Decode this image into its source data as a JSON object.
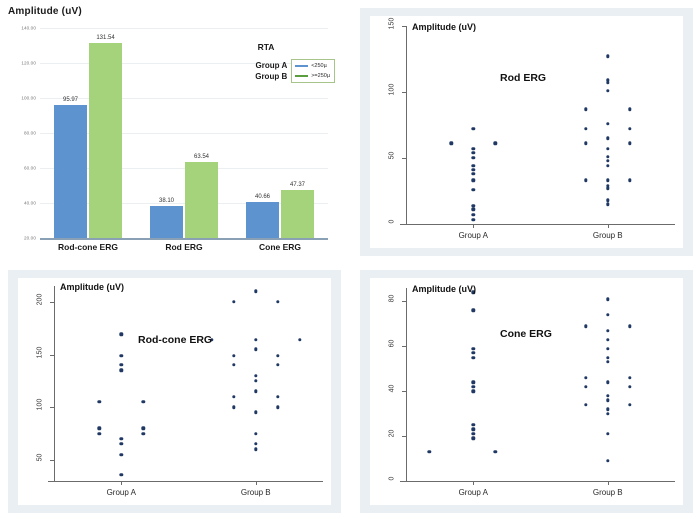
{
  "figure": {
    "panels": [
      "bar-chart-rta",
      "scatter-rod-erg",
      "scatter-rod-cone-erg",
      "scatter-cone-erg"
    ]
  },
  "colors": {
    "group_a_blue": "#5d93ce",
    "group_b_green": "#a5d37b",
    "legend_green_line": "#5a9e3f",
    "dot_navy": "#1f3864",
    "panel_background": "#e9eff3",
    "plot_background": "#ffffff"
  },
  "bar_chart": {
    "axis_title": "Amplitude (uV)",
    "legend": {
      "title": "RTA",
      "group_labels": [
        "Group A",
        "Group B"
      ],
      "entries": [
        {
          "label": "<250µ",
          "color": "#5d93ce"
        },
        {
          "label": ">=250µ",
          "color": "#5a9e3f"
        }
      ]
    },
    "chart_data": {
      "type": "bar",
      "title": "Amplitude (uV)",
      "xlabel": "",
      "ylabel": "Amplitude (uV)",
      "ylim": [
        20,
        140
      ],
      "yticks": [
        "20.00",
        "40.00",
        "60.00",
        "80.00",
        "100.00",
        "120.00",
        "140.00"
      ],
      "grid": true,
      "legend_position": "top-right",
      "categories": [
        "Rod-cone ERG",
        "Rod ERG",
        "Cone ERG"
      ],
      "series": [
        {
          "name": "Group A",
          "legend": "<250µ",
          "color": "#5d93ce",
          "values": [
            95.97,
            38.1,
            40.66
          ],
          "labels": [
            "95.97",
            "38.10",
            "40.66"
          ]
        },
        {
          "name": "Group B",
          "legend": ">=250µ",
          "color": "#a5d37b",
          "values": [
            131.54,
            63.54,
            47.37
          ],
          "labels": [
            "131.54",
            "63.54",
            "47.37"
          ]
        }
      ]
    }
  },
  "scatter_rod": {
    "axis_title": "Amplitude (uV)",
    "chart_data": {
      "type": "scatter",
      "title": "Rod ERG",
      "xlabel": "",
      "ylabel": "Amplitude (uV)",
      "ylim": [
        0,
        150
      ],
      "yticks": [
        0,
        50,
        100,
        150
      ],
      "grid": false,
      "categories": [
        "Group A",
        "Group B"
      ],
      "series": [
        {
          "name": "Group A",
          "points": [
            {
              "offset": -1,
              "y": 61
            },
            {
              "offset": 1,
              "y": 61
            },
            {
              "offset": 0,
              "y": 72
            },
            {
              "offset": 0,
              "y": 57
            },
            {
              "offset": 0,
              "y": 54
            },
            {
              "offset": 0,
              "y": 50
            },
            {
              "offset": 0,
              "y": 44
            },
            {
              "offset": 0,
              "y": 41
            },
            {
              "offset": 0,
              "y": 38
            },
            {
              "offset": 0,
              "y": 33
            },
            {
              "offset": 0,
              "y": 26
            },
            {
              "offset": 0,
              "y": 14
            },
            {
              "offset": 0,
              "y": 11
            },
            {
              "offset": 0,
              "y": 7
            },
            {
              "offset": 0,
              "y": 3
            }
          ]
        },
        {
          "name": "Group B",
          "points": [
            {
              "offset": 0,
              "y": 127
            },
            {
              "offset": 0,
              "y": 109
            },
            {
              "offset": 0,
              "y": 107
            },
            {
              "offset": 0,
              "y": 101
            },
            {
              "offset": -1,
              "y": 87
            },
            {
              "offset": 1,
              "y": 87
            },
            {
              "offset": -1,
              "y": 72
            },
            {
              "offset": 0,
              "y": 76
            },
            {
              "offset": 1,
              "y": 72
            },
            {
              "offset": -1,
              "y": 61
            },
            {
              "offset": 0,
              "y": 65
            },
            {
              "offset": 1,
              "y": 61
            },
            {
              "offset": 0,
              "y": 57
            },
            {
              "offset": 0,
              "y": 51
            },
            {
              "offset": 0,
              "y": 48
            },
            {
              "offset": 0,
              "y": 44
            },
            {
              "offset": -1,
              "y": 33
            },
            {
              "offset": 0,
              "y": 33
            },
            {
              "offset": 1,
              "y": 33
            },
            {
              "offset": 0,
              "y": 29
            },
            {
              "offset": 0,
              "y": 27
            },
            {
              "offset": 0,
              "y": 18
            },
            {
              "offset": 0,
              "y": 15
            }
          ]
        }
      ]
    }
  },
  "scatter_rod_cone": {
    "axis_title": "Amplitude (uV)",
    "chart_data": {
      "type": "scatter",
      "title": "Rod-cone ERG",
      "xlabel": "",
      "ylabel": "Amplitude (uV)",
      "ylim": [
        30,
        215
      ],
      "yticks": [
        50,
        100,
        150,
        200
      ],
      "grid": false,
      "categories": [
        "Group A",
        "Group B"
      ],
      "series": [
        {
          "name": "Group A",
          "points": [
            {
              "offset": 0,
              "y": 169
            },
            {
              "offset": 0,
              "y": 149
            },
            {
              "offset": 0,
              "y": 140
            },
            {
              "offset": 0,
              "y": 135
            },
            {
              "offset": -1,
              "y": 105
            },
            {
              "offset": 1,
              "y": 105
            },
            {
              "offset": -1,
              "y": 80
            },
            {
              "offset": 1,
              "y": 80
            },
            {
              "offset": -1,
              "y": 75
            },
            {
              "offset": 1,
              "y": 75
            },
            {
              "offset": 0,
              "y": 70
            },
            {
              "offset": 0,
              "y": 65
            },
            {
              "offset": 0,
              "y": 55
            },
            {
              "offset": 0,
              "y": 36
            }
          ]
        },
        {
          "name": "Group B",
          "points": [
            {
              "offset": 0,
              "y": 210
            },
            {
              "offset": -1,
              "y": 200
            },
            {
              "offset": 1,
              "y": 200
            },
            {
              "offset": -2,
              "y": 164
            },
            {
              "offset": 0,
              "y": 164
            },
            {
              "offset": 2,
              "y": 164
            },
            {
              "offset": 0,
              "y": 155
            },
            {
              "offset": -1,
              "y": 149
            },
            {
              "offset": 1,
              "y": 149
            },
            {
              "offset": -1,
              "y": 140
            },
            {
              "offset": 1,
              "y": 140
            },
            {
              "offset": 0,
              "y": 130
            },
            {
              "offset": 0,
              "y": 125
            },
            {
              "offset": 0,
              "y": 115
            },
            {
              "offset": -1,
              "y": 110
            },
            {
              "offset": 1,
              "y": 110
            },
            {
              "offset": -1,
              "y": 100
            },
            {
              "offset": 1,
              "y": 100
            },
            {
              "offset": 0,
              "y": 95
            },
            {
              "offset": 0,
              "y": 75
            },
            {
              "offset": 0,
              "y": 65
            },
            {
              "offset": 0,
              "y": 60
            }
          ]
        }
      ]
    }
  },
  "scatter_cone": {
    "axis_title": "Amplitude (uV)",
    "chart_data": {
      "type": "scatter",
      "title": "Cone ERG",
      "xlabel": "",
      "ylabel": "Amplitude (uV)",
      "ylim": [
        0,
        86
      ],
      "yticks": [
        0,
        20,
        40,
        60,
        80
      ],
      "grid": false,
      "categories": [
        "Group A",
        "Group B"
      ],
      "series": [
        {
          "name": "Group A",
          "points": [
            {
              "offset": 0,
              "y": 84
            },
            {
              "offset": 0,
              "y": 76
            },
            {
              "offset": 0,
              "y": 59
            },
            {
              "offset": 0,
              "y": 57
            },
            {
              "offset": 0,
              "y": 55
            },
            {
              "offset": 0,
              "y": 44
            },
            {
              "offset": 0,
              "y": 42
            },
            {
              "offset": 0,
              "y": 40
            },
            {
              "offset": 0,
              "y": 25
            },
            {
              "offset": 0,
              "y": 23
            },
            {
              "offset": 0,
              "y": 21
            },
            {
              "offset": 0,
              "y": 19
            },
            {
              "offset": -2,
              "y": 13
            },
            {
              "offset": 1,
              "y": 13
            }
          ]
        },
        {
          "name": "Group B",
          "points": [
            {
              "offset": 0,
              "y": 81
            },
            {
              "offset": 0,
              "y": 74
            },
            {
              "offset": -1,
              "y": 69
            },
            {
              "offset": 1,
              "y": 69
            },
            {
              "offset": 0,
              "y": 67
            },
            {
              "offset": 0,
              "y": 63
            },
            {
              "offset": 0,
              "y": 59
            },
            {
              "offset": 0,
              "y": 55
            },
            {
              "offset": 0,
              "y": 53
            },
            {
              "offset": -1,
              "y": 46
            },
            {
              "offset": 1,
              "y": 46
            },
            {
              "offset": -1,
              "y": 42
            },
            {
              "offset": 1,
              "y": 42
            },
            {
              "offset": 0,
              "y": 44
            },
            {
              "offset": 0,
              "y": 38
            },
            {
              "offset": 0,
              "y": 36
            },
            {
              "offset": -1,
              "y": 34
            },
            {
              "offset": 1,
              "y": 34
            },
            {
              "offset": 0,
              "y": 32
            },
            {
              "offset": 0,
              "y": 30
            },
            {
              "offset": 0,
              "y": 21
            },
            {
              "offset": 0,
              "y": 9
            }
          ]
        }
      ]
    }
  }
}
